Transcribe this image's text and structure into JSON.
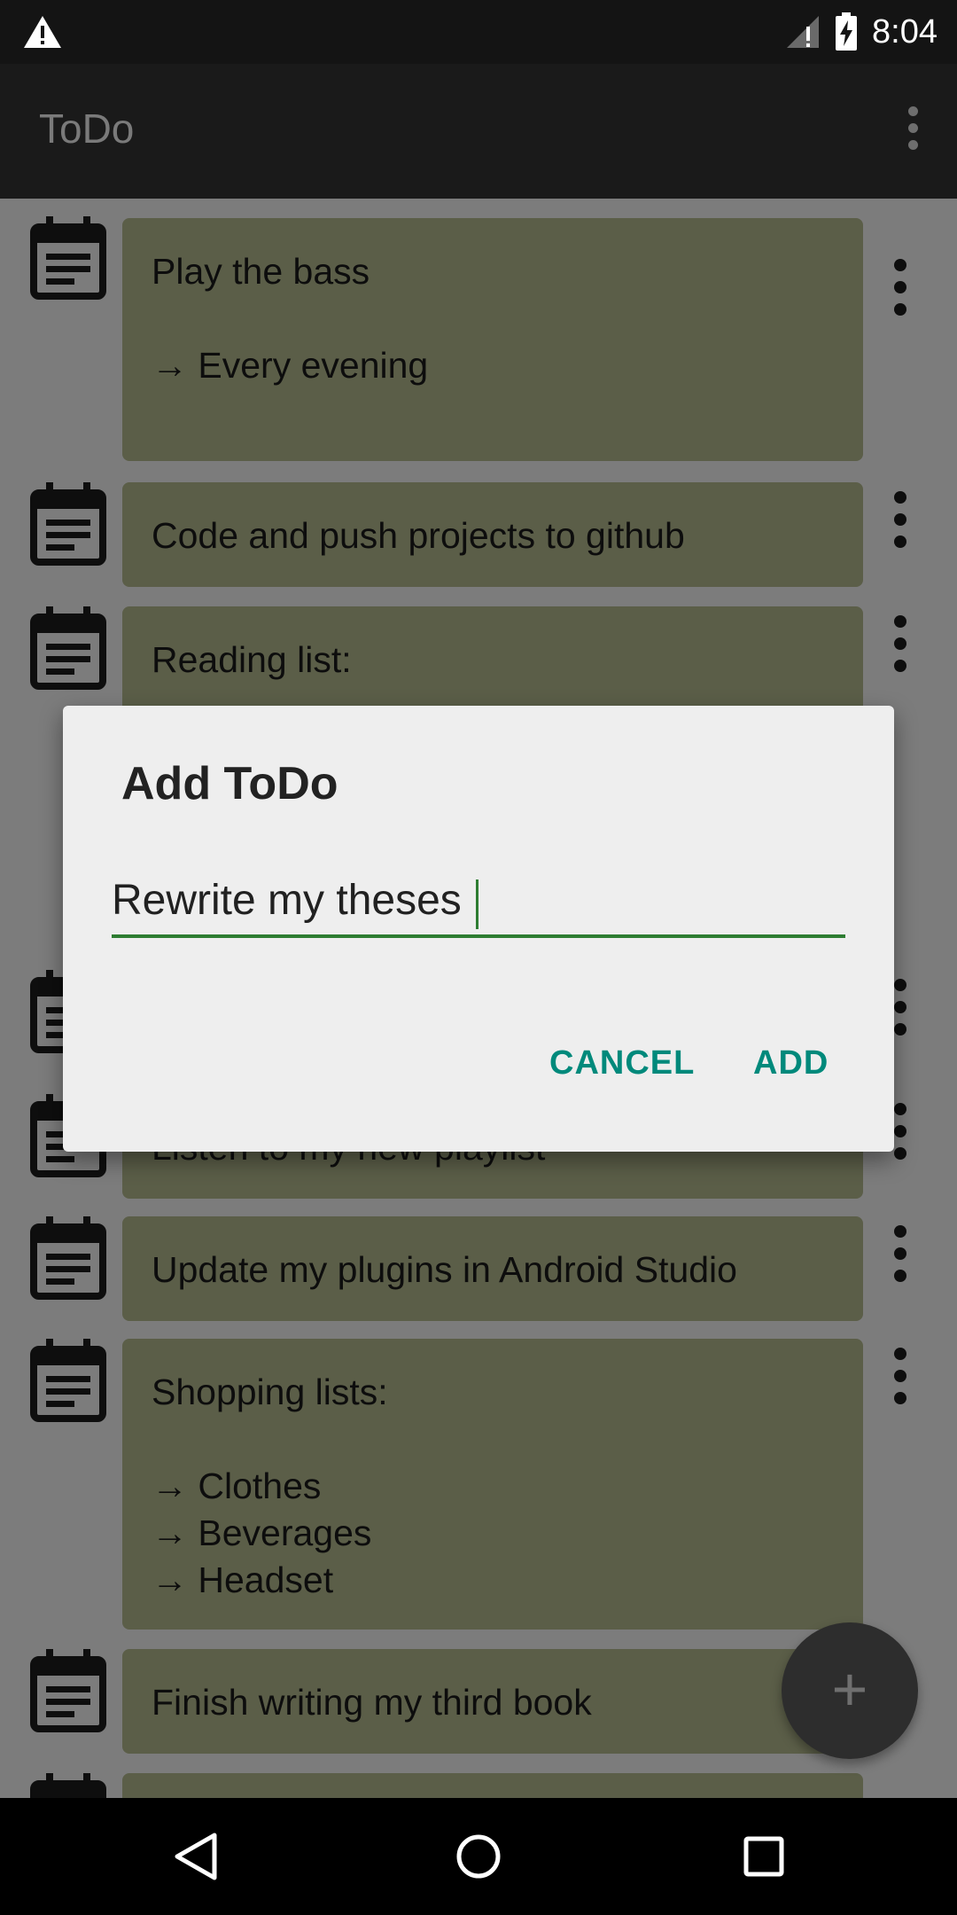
{
  "status": {
    "time": "8:04"
  },
  "app": {
    "title": "ToDo"
  },
  "todos": [
    {
      "text": "Play the bass\n\n→ Every evening"
    },
    {
      "text": "Code and push projects to github"
    },
    {
      "text": "Reading list:"
    },
    {
      "text": ""
    },
    {
      "text": "Listen to my new playlist"
    },
    {
      "text": "Update my plugins in Android Studio"
    },
    {
      "text": "Shopping lists:\n\n→ Clothes\n→ Beverages\n→ Headset"
    },
    {
      "text": "Finish writing my third book"
    }
  ],
  "dialog": {
    "title": "Add ToDo",
    "input_value": "Rewrite my theses ",
    "cancel_label": "CANCEL",
    "add_label": "ADD"
  },
  "fab": {
    "icon": "plus-icon",
    "label": "+"
  },
  "colors": {
    "accent": "#00897b",
    "input_underline": "#2e7d32",
    "card": "#5b5e48"
  }
}
